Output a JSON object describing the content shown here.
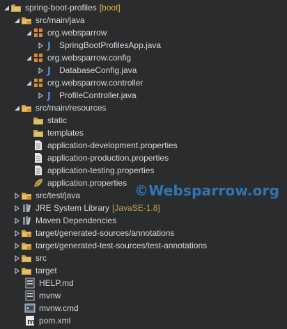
{
  "project": {
    "name": "spring-boot-profiles",
    "tag": "[boot]"
  },
  "tree": {
    "src_main_java": "src/main/java",
    "pkg1": "org.websparrow",
    "file1": "SpringBootProfilesApp.java",
    "pkg2": "org.websparrow.config",
    "file2": "DatabaseConfig.java",
    "pkg3": "org.websparrow.controller",
    "file3": "ProfileController.java",
    "src_main_resources": "src/main/resources",
    "static": "static",
    "templates": "templates",
    "prop_dev": "application-development.properties",
    "prop_prod": "application-production.properties",
    "prop_test": "application-testing.properties",
    "prop_main": "application.properties",
    "src_test_java": "src/test/java",
    "jre": "JRE System Library",
    "jre_tag": "[JavaSE-1.8]",
    "maven": "Maven Dependencies",
    "gen_sources": "target/generated-sources/annotations",
    "gen_test_sources": "target/generated-test-sources/test-annotations",
    "src": "src",
    "target": "target",
    "help": "HELP.md",
    "mvnw": "mvnw",
    "mvnw_cmd": "mvnw.cmd",
    "pom": "pom.xml"
  },
  "watermark": "©Websparrow.org",
  "colors": {
    "background": "#2b2c2e",
    "text": "#d6d8da",
    "tag": "#e0b44a",
    "watermark": "#2f77b3",
    "folder": "#c9a24b",
    "package": "#d88a2c",
    "java_file": "#5a8fd6"
  },
  "icons": {
    "project": "project-folder-icon",
    "source_folder": "source-folder-icon",
    "package": "package-icon",
    "java_file": "java-file-icon",
    "folder": "folder-icon",
    "properties_file": "properties-file-icon",
    "spring_properties": "spring-leaf-icon",
    "library": "library-icon",
    "text_file": "text-file-icon",
    "cmd_file": "cmd-file-icon",
    "maven_file": "maven-pom-icon"
  }
}
